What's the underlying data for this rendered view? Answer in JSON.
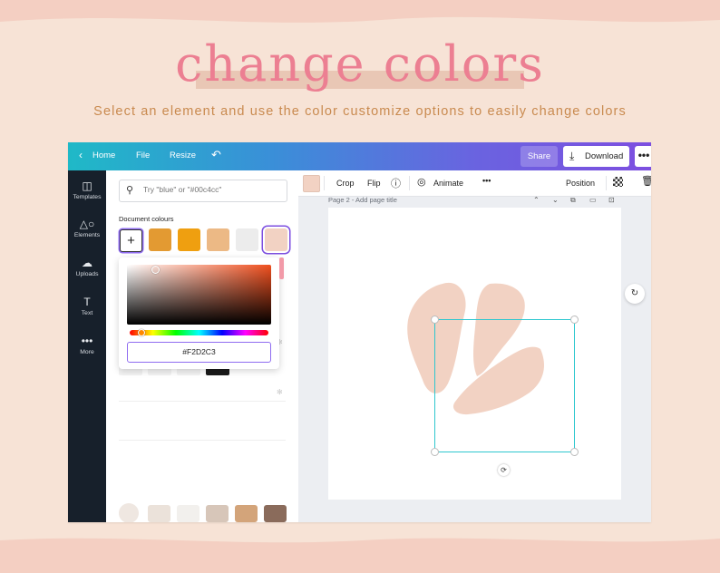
{
  "hero": {
    "title": "change colors",
    "subtitle": "Select an element and use the color customize options to easily change colors"
  },
  "colors": {
    "hero_title": "#ec7f92",
    "hero_subtitle": "#c98a4f",
    "accent_purple": "#7d4fe0",
    "selection_teal": "#2ec7cf",
    "petal": "#f2d2c3"
  },
  "topbar": {
    "back_icon": "chevron-left-icon",
    "home": "Home",
    "file": "File",
    "resize": "Resize",
    "undo_icon": "undo-icon",
    "share": "Share",
    "download": "Download",
    "download_icon": "download-icon",
    "more_icon": "more-icon"
  },
  "rail": {
    "items": [
      {
        "label": "Templates",
        "icon": "templates-icon"
      },
      {
        "label": "Elements",
        "icon": "elements-icon"
      },
      {
        "label": "Uploads",
        "icon": "uploads-icon"
      },
      {
        "label": "Text",
        "icon": "text-icon"
      },
      {
        "label": "More",
        "icon": "more-icon"
      }
    ]
  },
  "panel": {
    "search_placeholder": "Try \"blue\" or \"#00c4cc\"",
    "document_colours_label": "Document colours",
    "document_colours": [
      "#e39a32",
      "#ef9f10",
      "#ecb985",
      "#ececec",
      "#f2d2c3"
    ],
    "selected_colour": "#f2d2c3",
    "picker": {
      "hex_value": "#F2D2C3",
      "base_hue": "#f04f1e"
    },
    "faint_row_colours": [
      "#f3f3f3",
      "#f3f3f3",
      "#f3f3f3",
      "#1a1a1a"
    ],
    "bottom_row_colours": [
      "#ebe2da",
      "#f2f0ed",
      "#d7c6b9",
      "#d3a47a",
      "#8a6b5b"
    ]
  },
  "context_bar": {
    "crop": "Crop",
    "flip": "Flip",
    "info_icon": "info-icon",
    "animate": "Animate",
    "animate_icon": "animate-icon",
    "more_icon": "more-icon",
    "position": "Position",
    "transparency_icon": "transparency-icon",
    "delete_icon": "trash-icon"
  },
  "canvas": {
    "page_title": "Page 2 - Add page title",
    "rotate_icon": "rotate-icon",
    "comment_icon": "comment-icon"
  }
}
